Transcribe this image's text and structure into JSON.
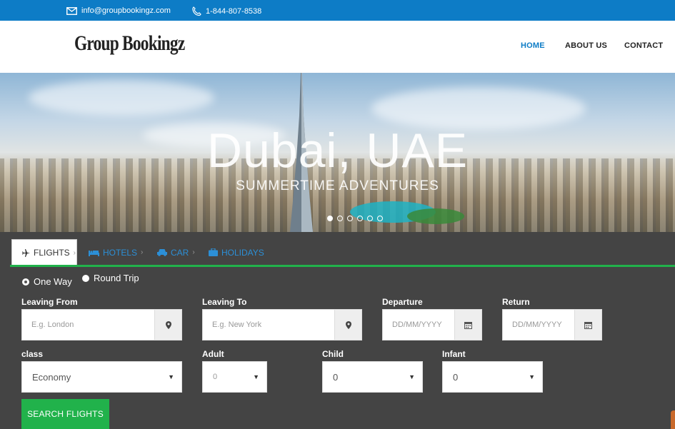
{
  "topbar": {
    "email": "info@groupbookingz.com",
    "phone": "1-844-807-8538",
    "email_icon": "envelope-icon",
    "phone_icon": "phone-icon"
  },
  "header": {
    "logo": "Group Bookingz",
    "nav": [
      {
        "label": "HOME",
        "active": true
      },
      {
        "label": "ABOUT US",
        "active": false
      },
      {
        "label": "CONTACT",
        "active": false
      }
    ]
  },
  "hero": {
    "title": "Dubai, UAE",
    "subtitle": "SUMMERTIME ADVENTURES",
    "slides": 6,
    "active_slide": 0
  },
  "search": {
    "tabs": [
      {
        "label": "FLIGHTS",
        "icon": "plane-icon",
        "active": true
      },
      {
        "label": "HOTELS",
        "icon": "bed-icon",
        "active": false
      },
      {
        "label": "CAR",
        "icon": "car-icon",
        "active": false
      },
      {
        "label": "HOLIDAYS",
        "icon": "suitcase-icon",
        "active": false
      }
    ],
    "trip_types": [
      {
        "label": "One Way",
        "checked": true
      },
      {
        "label": "Round Trip",
        "checked": false
      }
    ],
    "leaving_from": {
      "label": "Leaving From",
      "placeholder": "E.g. London"
    },
    "leaving_to": {
      "label": "Leaving To",
      "placeholder": "E.g. New York"
    },
    "departure": {
      "label": "Departure",
      "placeholder": "DD/MM/YYYY"
    },
    "return": {
      "label": "Return",
      "placeholder": "DD/MM/YYYY"
    },
    "class": {
      "label": "class",
      "value": "Economy"
    },
    "adult": {
      "label": "Adult",
      "value": "0"
    },
    "child": {
      "label": "Child",
      "value": "0"
    },
    "infant": {
      "label": "Infant",
      "value": "0"
    },
    "submit_label": "SEARCH FLIGHTS"
  },
  "colors": {
    "brand_blue": "#0d7cc6",
    "accent_green": "#21b24b",
    "panel_bg": "#444444"
  }
}
